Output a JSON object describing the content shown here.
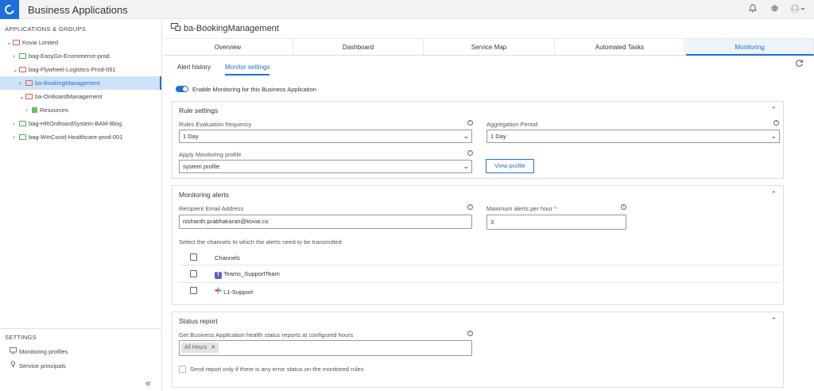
{
  "app": {
    "title": "Business Applications"
  },
  "sidebar": {
    "section_title": "APPLICATIONS & GROUPS",
    "tree": [
      {
        "label": "Kovai Limited",
        "color": "red",
        "expanded": true
      },
      {
        "label": "bag-EasyGo-Ecommerce-prod",
        "color": "green"
      },
      {
        "label": "bag-Flywheel-Logistics-Prod-051",
        "color": "red",
        "expanded": true
      },
      {
        "label": "ba-BookingManagement",
        "color": "red",
        "selected": true
      },
      {
        "label": "ba-OnBoardManagement",
        "color": "red",
        "expanded": true
      },
      {
        "label": "Resources",
        "color": "green"
      },
      {
        "label": "bag-HROnBoardSystem-BAM-Blog",
        "color": "green"
      },
      {
        "label": "bag-WinCovid-Healthcare-prod-001",
        "color": "green"
      }
    ],
    "settings_title": "SETTINGS",
    "settings_items": [
      {
        "label": "Monitoring profiles",
        "icon": "monitor-icon"
      },
      {
        "label": "Service principals",
        "icon": "key-icon"
      }
    ],
    "collapse_icon": "«"
  },
  "page": {
    "title": "ba-BookingManagement",
    "tabs": [
      "Overview",
      "Dashboard",
      "Service Map",
      "Automated Tasks",
      "Monitoring"
    ],
    "active_tab": "Monitoring",
    "subtabs": [
      "Alert history",
      "Monitor settings"
    ],
    "active_subtab": "Monitor settings",
    "toggle_label": "Enable Monitoring for this Business Application",
    "toggle_on": true
  },
  "rule_settings": {
    "title": "Rule settings",
    "eval_freq_label": "Rules Evaluation frequency",
    "eval_freq_value": "1 Day",
    "agg_period_label": "Aggregation Period",
    "agg_period_value": "1 Day",
    "profile_label": "Apply Monitoring profile",
    "profile_value": "system profile",
    "view_profile_button": "View profile"
  },
  "monitoring_alerts": {
    "title": "Monitoring alerts",
    "email_label": "Recipient Email Address",
    "email_value": "nishanth.prabhakaran@kovai.co",
    "max_alerts_label": "Maximum alerts per hour",
    "max_alerts_required": "*",
    "max_alerts_value": "3",
    "channels_hint": "Select the channels to which the alerts need to be transmitted",
    "channels_header": "Channels",
    "channels": [
      {
        "name": "Teams_SupportTeam",
        "icon": "teams-icon"
      },
      {
        "name": "L1-Support",
        "icon": "slack-icon"
      }
    ]
  },
  "status_report": {
    "title": "Status report",
    "hours_label": "Get Business Application health status reports at configured hours",
    "hours_chip": "All Hours",
    "error_only_label": "Send report only if there is any error status on the monitored rules"
  },
  "colors": {
    "accent": "#1e6fd9",
    "selected_bg": "#cfe3f8"
  }
}
